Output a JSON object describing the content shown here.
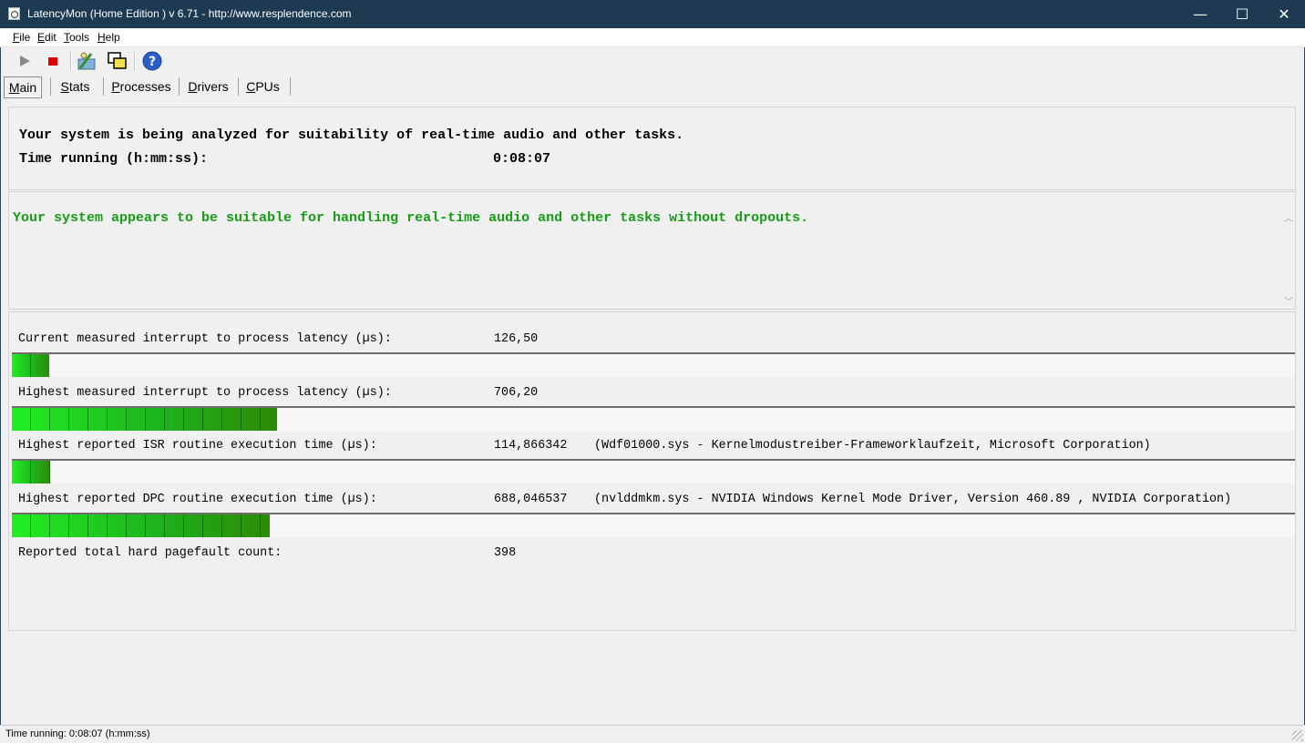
{
  "window": {
    "title": "LatencyMon  (Home Edition )  v 6.71 - http://www.resplendence.com",
    "minimize_glyph": "—",
    "maximize_glyph": "☐",
    "close_glyph": "✕"
  },
  "menu": {
    "file": {
      "mnemonic": "F",
      "rest": "ile"
    },
    "edit": {
      "mnemonic": "E",
      "rest": "dit"
    },
    "tools": {
      "mnemonic": "T",
      "rest": "ools"
    },
    "help": {
      "mnemonic": "H",
      "rest": "elp"
    }
  },
  "toolbar": {
    "icons": [
      "play-icon",
      "stop-icon",
      "analyze-icon",
      "windows-icon",
      "help-icon"
    ],
    "colors": {
      "play": "#8a8a8a",
      "stop": "#e00000",
      "help": "#2a5fc9"
    }
  },
  "tabs": [
    {
      "mnemonic": "M",
      "rest": "ain",
      "active": true
    },
    {
      "mnemonic": "S",
      "rest": "tats"
    },
    {
      "mnemonic": "P",
      "rest": "rocesses"
    },
    {
      "mnemonic": "D",
      "rest": "rivers"
    },
    {
      "mnemonic": "C",
      "rest": "PUs"
    }
  ],
  "analysis": {
    "line1": "Your system is being analyzed for suitability of real-time audio and other tasks.",
    "time_label": "Time running (h:mm:ss):",
    "time_value": "0:08:07"
  },
  "verdict": {
    "message": "Your system appears to be suitable for handling real-time audio and other tasks without dropouts.",
    "color": "#169c16"
  },
  "metrics": [
    {
      "label": "Current measured interrupt to process latency (µs):",
      "value": "126,50",
      "extra": "",
      "bar_fraction": 0.029
    },
    {
      "label": "Highest measured interrupt to process latency (µs):",
      "value": "706,20",
      "extra": "",
      "bar_fraction": 0.207
    },
    {
      "label": "Highest reported ISR routine execution time (µs):",
      "value": "114,866342",
      "extra": "(Wdf01000.sys - Kernelmodustreiber-Frameworklaufzeit, Microsoft Corporation)",
      "bar_fraction": 0.03
    },
    {
      "label": "Highest reported DPC routine execution time (µs):",
      "value": "688,046537",
      "extra": "(nvlddmkm.sys - NVIDIA Windows Kernel Mode Driver, Version 460.89 , NVIDIA Corporation)",
      "bar_fraction": 0.201
    },
    {
      "label": "Reported total hard pagefault count:",
      "value": "398",
      "extra": ""
    }
  ],
  "statusbar": {
    "text": "Time running: 0:08:07  (h:mm:ss)"
  }
}
